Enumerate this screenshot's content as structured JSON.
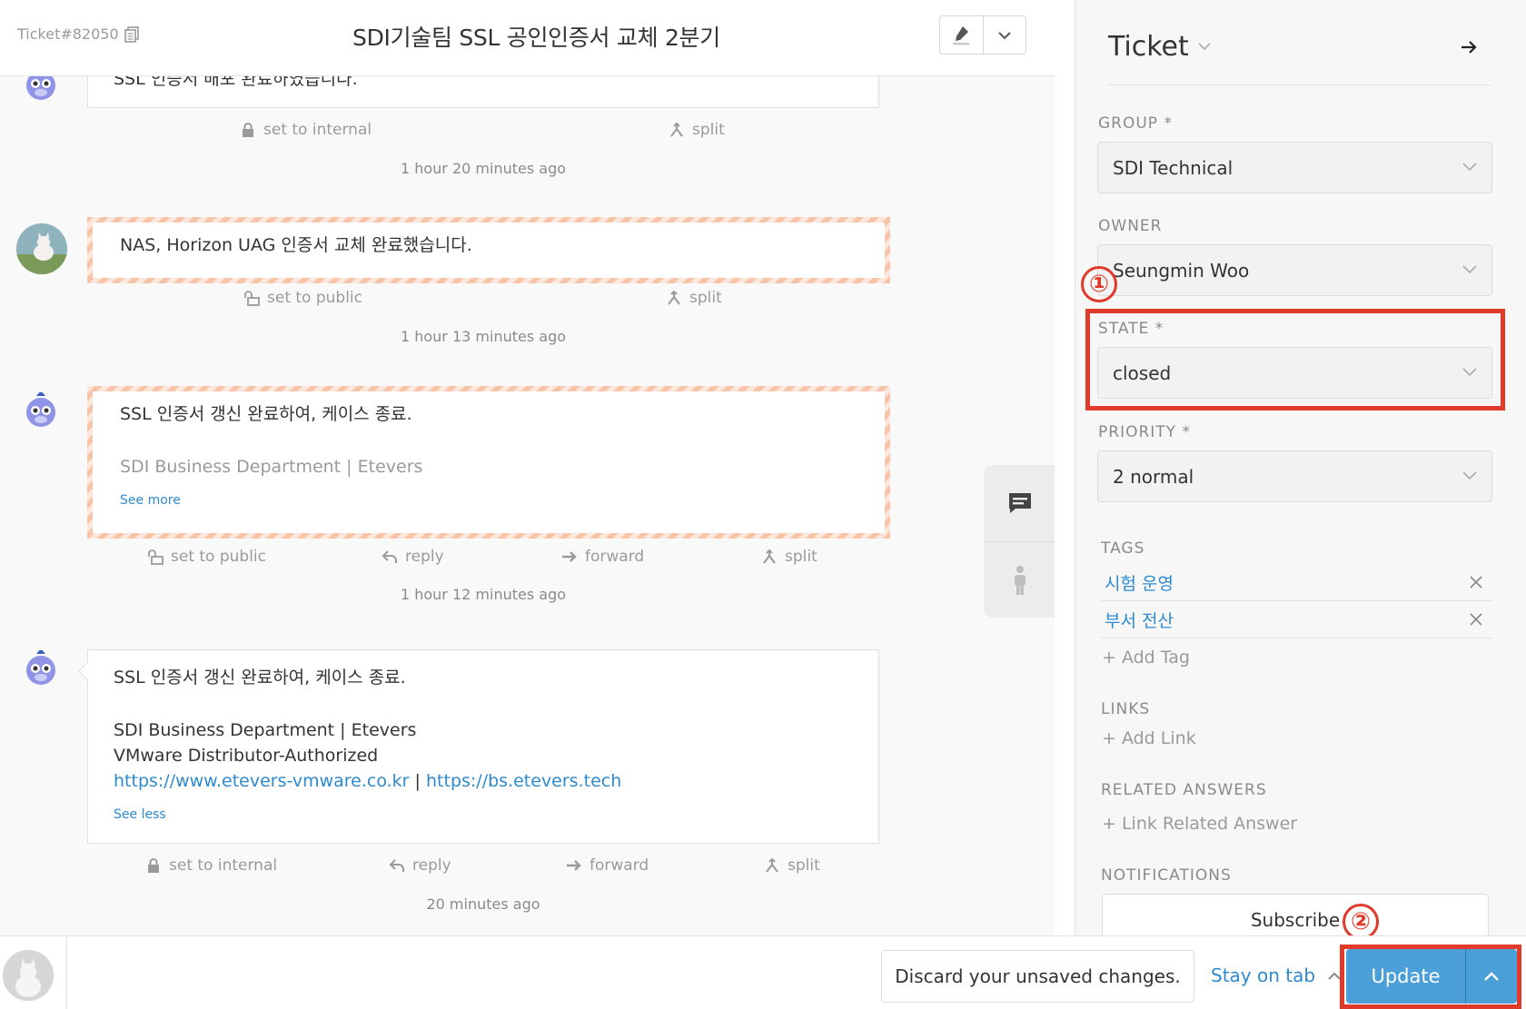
{
  "header": {
    "ticket_number": "Ticket#82050",
    "title": "SDI기술팀 SSL 공인인증서 교체 2분기"
  },
  "timeline": {
    "articles": [
      {
        "body": "SSL 인증서 배포 완료하였습니다.",
        "actions": [
          "set to internal",
          "split"
        ],
        "timestamp": "1 hour 20 minutes ago"
      },
      {
        "body": "NAS, Horizon UAG 인증서 교체 완료했습니다.",
        "actions": [
          "set to public",
          "split"
        ],
        "timestamp": "1 hour 13 minutes ago"
      },
      {
        "body": "SSL 인증서 갱신 완료하여, 케이스 종료.",
        "signature": "SDI Business Department | Etevers",
        "toggle": "See more",
        "actions": [
          "set to public",
          "reply",
          "forward",
          "split"
        ],
        "timestamp": "1 hour 12 minutes ago"
      },
      {
        "body": "SSL 인증서 갱신 완료하여, 케이스 종료.",
        "sig_line1": "SDI Business Department | Etevers",
        "sig_line2": "VMware Distributor-Authorized",
        "link1": "https://www.etevers-vmware.co.kr",
        "separator": "|",
        "link2": "https://bs.etevers.tech",
        "toggle": "See less",
        "actions": [
          "set to internal",
          "reply",
          "forward",
          "split"
        ],
        "timestamp": "20 minutes ago"
      }
    ]
  },
  "sidebar": {
    "title": "Ticket",
    "group_label": "GROUP *",
    "group_value": "SDI Technical",
    "owner_label": "OWNER",
    "owner_value": "Seungmin Woo",
    "state_label": "STATE *",
    "state_value": "closed",
    "priority_label": "PRIORITY *",
    "priority_value": "2 normal",
    "tags_label": "TAGS",
    "tags": [
      "시험 운영",
      "부서 전산"
    ],
    "add_tag": "+ Add Tag",
    "links_label": "LINKS",
    "add_link": "+ Add Link",
    "related_label": "RELATED ANSWERS",
    "link_related": "+ Link Related Answer",
    "notifications_label": "NOTIFICATIONS",
    "subscribe": "Subscribe"
  },
  "annotations": {
    "marker1": "①",
    "marker2": "②",
    "color": "#e03a2a"
  },
  "bottom_bar": {
    "discard": "Discard your unsaved changes.",
    "stay_on_tab": "Stay on tab",
    "update": "Update"
  },
  "colors": {
    "accent": "#2d8ad0",
    "update_button": "#4a9fd8",
    "internal_stripe": "#f8c4a8"
  }
}
